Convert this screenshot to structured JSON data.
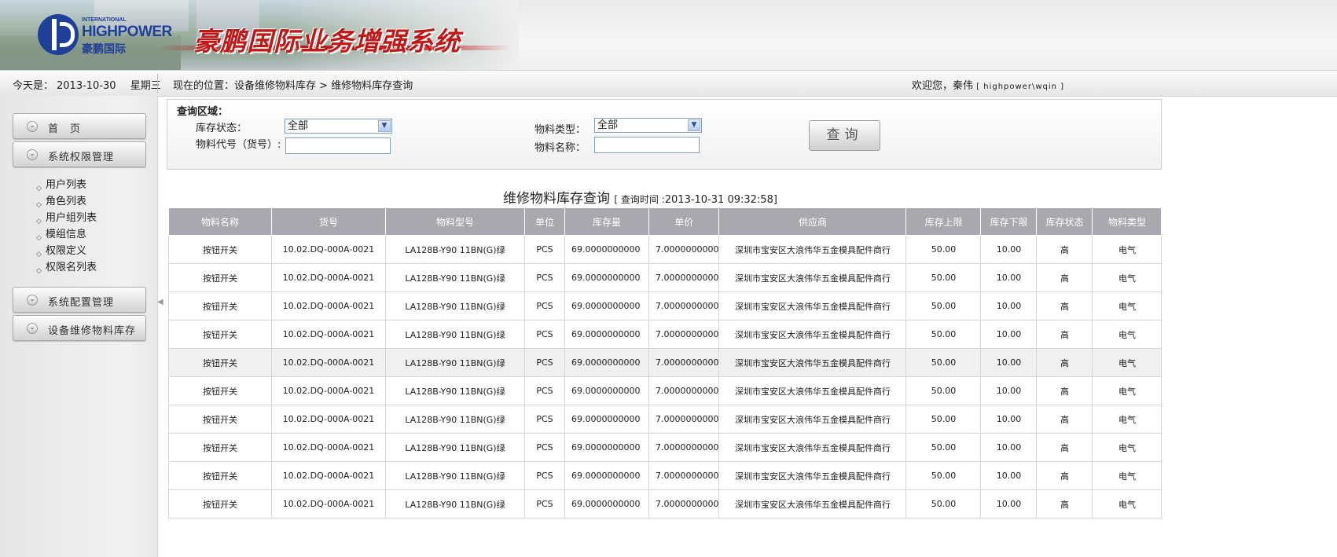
{
  "header": {
    "logo_intl": "INTERNATIONAL",
    "logo_en": "HIGHPOWER",
    "logo_cn": "豪鹏国际",
    "system_title": "豪鹏国际业务增强系统"
  },
  "infobar": {
    "date_label": "今天是：",
    "date": "2013-10-30",
    "weekday": "星期三",
    "position_label": "现在的位置：",
    "position_path": "设备维修物料库存",
    "position_sep": " > ",
    "position_current": "维修物料库存查询",
    "welcome": "欢迎您，秦伟",
    "account": "[ highpower\\wqin ]"
  },
  "sidebar": {
    "menus": [
      {
        "label": "首　页"
      },
      {
        "label": "系统权限管理"
      },
      {
        "label": "系统配置管理"
      },
      {
        "label": "设备维修物料库存"
      }
    ],
    "sub_items": [
      "用户列表",
      "角色列表",
      "用户组列表",
      "模组信息",
      "权限定义",
      "权限名列表"
    ]
  },
  "query": {
    "title": "查询区域：",
    "stock_status_label": "库存状态：",
    "stock_status_value": "全部",
    "material_type_label": "物料类型：",
    "material_type_value": "全部",
    "material_code_label": "物料代号（货号）:",
    "material_code_value": "",
    "material_name_label": "物料名称：",
    "material_name_value": "",
    "search_button": "查询"
  },
  "result": {
    "title": "维修物料库存查询",
    "query_time_prefix": "[ 查询时间 :",
    "query_time": "2013-10-31 09:32:58",
    "query_time_suffix": "]"
  },
  "table": {
    "columns": [
      "物料名称",
      "货号",
      "物料型号",
      "单位",
      "库存量",
      "单价",
      "供应商",
      "库存上限",
      "库存下限",
      "库存状态",
      "物料类型"
    ],
    "rows": [
      [
        "按钮开关",
        "10.02.DQ-000A-0021",
        "LA128B-Y90 11BN(G)绿",
        "PCS",
        "69.0000000000",
        "7.0000000000",
        "深圳市宝安区大浪伟华五金模具配件商行",
        "50.00",
        "10.00",
        "高",
        "电气"
      ],
      [
        "按钮开关",
        "10.02.DQ-000A-0021",
        "LA128B-Y90 11BN(G)绿",
        "PCS",
        "69.0000000000",
        "7.0000000000",
        "深圳市宝安区大浪伟华五金模具配件商行",
        "50.00",
        "10.00",
        "高",
        "电气"
      ],
      [
        "按钮开关",
        "10.02.DQ-000A-0021",
        "LA128B-Y90 11BN(G)绿",
        "PCS",
        "69.0000000000",
        "7.0000000000",
        "深圳市宝安区大浪伟华五金模具配件商行",
        "50.00",
        "10.00",
        "高",
        "电气"
      ],
      [
        "按钮开关",
        "10.02.DQ-000A-0021",
        "LA128B-Y90 11BN(G)绿",
        "PCS",
        "69.0000000000",
        "7.0000000000",
        "深圳市宝安区大浪伟华五金模具配件商行",
        "50.00",
        "10.00",
        "高",
        "电气"
      ],
      [
        "按钮开关",
        "10.02.DQ-000A-0021",
        "LA128B-Y90 11BN(G)绿",
        "PCS",
        "69.0000000000",
        "7.0000000000",
        "深圳市宝安区大浪伟华五金模具配件商行",
        "50.00",
        "10.00",
        "高",
        "电气"
      ],
      [
        "按钮开关",
        "10.02.DQ-000A-0021",
        "LA128B-Y90 11BN(G)绿",
        "PCS",
        "69.0000000000",
        "7.0000000000",
        "深圳市宝安区大浪伟华五金模具配件商行",
        "50.00",
        "10.00",
        "高",
        "电气"
      ],
      [
        "按钮开关",
        "10.02.DQ-000A-0021",
        "LA128B-Y90 11BN(G)绿",
        "PCS",
        "69.0000000000",
        "7.0000000000",
        "深圳市宝安区大浪伟华五金模具配件商行",
        "50.00",
        "10.00",
        "高",
        "电气"
      ],
      [
        "按钮开关",
        "10.02.DQ-000A-0021",
        "LA128B-Y90 11BN(G)绿",
        "PCS",
        "69.0000000000",
        "7.0000000000",
        "深圳市宝安区大浪伟华五金模具配件商行",
        "50.00",
        "10.00",
        "高",
        "电气"
      ],
      [
        "按钮开关",
        "10.02.DQ-000A-0021",
        "LA128B-Y90 11BN(G)绿",
        "PCS",
        "69.0000000000",
        "7.0000000000",
        "深圳市宝安区大浪伟华五金模具配件商行",
        "50.00",
        "10.00",
        "高",
        "电气"
      ],
      [
        "按钮开关",
        "10.02.DQ-000A-0021",
        "LA128B-Y90 11BN(G)绿",
        "PCS",
        "69.0000000000",
        "7.0000000000",
        "深圳市宝安区大浪伟华五金模具配件商行",
        "50.00",
        "10.00",
        "高",
        "电气"
      ]
    ],
    "highlighted_row": 4
  }
}
